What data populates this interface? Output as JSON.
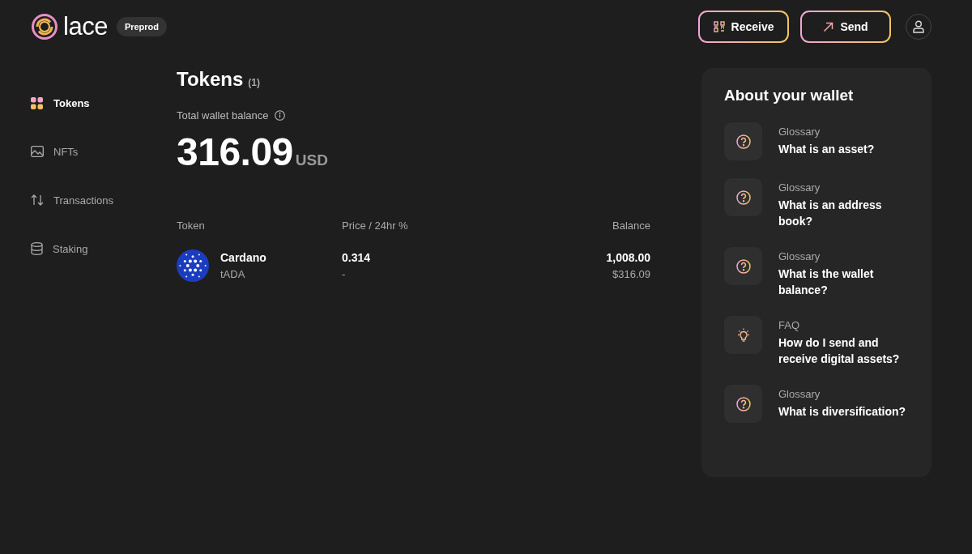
{
  "header": {
    "logo_text": "lace",
    "network_badge": "Preprod",
    "buttons": [
      {
        "label": "Receive",
        "kind": "receive"
      },
      {
        "label": "Send",
        "kind": "send"
      }
    ]
  },
  "sidebar": {
    "items": [
      {
        "label": "Tokens",
        "kind": "tokens",
        "selected": true
      },
      {
        "label": "NFTs",
        "kind": "nfts",
        "selected": false
      },
      {
        "label": "Transactions",
        "kind": "transactions",
        "selected": false
      },
      {
        "label": "Staking",
        "kind": "staking",
        "selected": false
      }
    ]
  },
  "main": {
    "title": "Tokens",
    "count": "(1)",
    "balance_label": "Total wallet balance",
    "balance": "316.09",
    "currency": "USD",
    "table": {
      "columns": [
        "Token",
        "Price / 24hr %",
        "Balance"
      ],
      "rows": [
        {
          "name": "Cardano",
          "ticker": "tADA",
          "price": "0.314",
          "change": "-",
          "amount": "1,008.00",
          "value": "$316.09"
        }
      ]
    }
  },
  "about": {
    "title": "About your wallet",
    "items": [
      {
        "kind": "question",
        "category": "Glossary",
        "title": "What is an asset?"
      },
      {
        "kind": "question",
        "category": "Glossary",
        "title": "What is an address book?"
      },
      {
        "kind": "question",
        "category": "Glossary",
        "title": "What is the wallet balance?"
      },
      {
        "kind": "tip",
        "category": "FAQ",
        "title": "How do I send and receive digital assets?"
      },
      {
        "kind": "question",
        "category": "Glossary",
        "title": "What is diversification?"
      }
    ]
  }
}
